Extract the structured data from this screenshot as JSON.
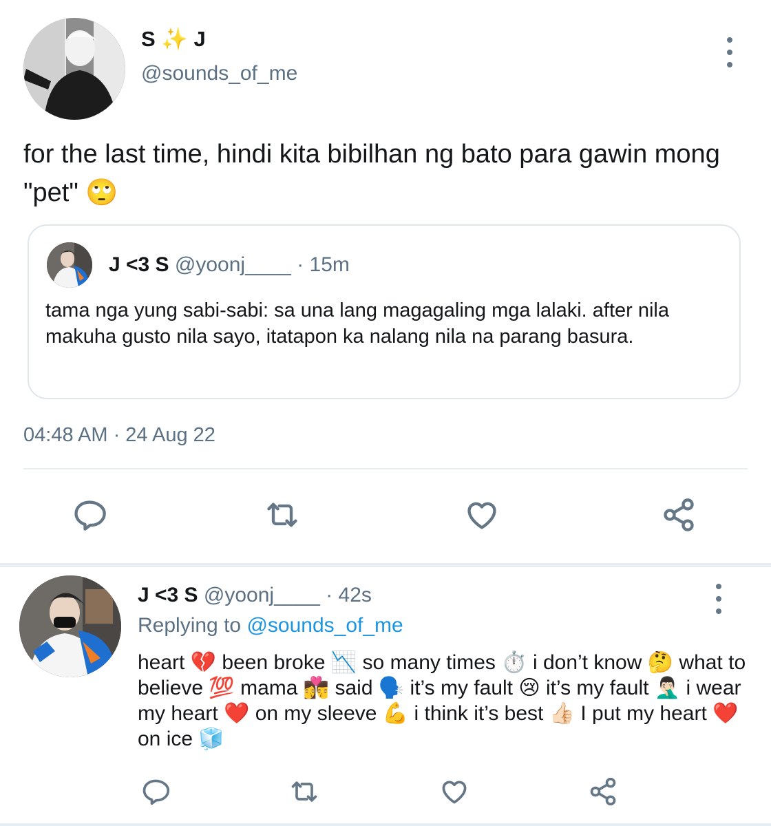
{
  "main_tweet": {
    "display_name": "S ✨ J",
    "handle": "@sounds_of_me",
    "text": "for the last time, hindi kita bibilhan ng bato para gawin mong \"pet\" 🙄",
    "timestamp": "04:48 AM · 24 Aug 22",
    "quoted": {
      "display_name": "J <3 S",
      "handle": "@yoonj____",
      "time": "· 15m",
      "text": "tama nga yung sabi-sabi: sa una lang magagaling mga lalaki. after nila makuha gusto nila sayo, itatapon ka nalang nila na parang basura."
    },
    "actions": [
      "reply-icon",
      "retweet-icon",
      "like-icon",
      "share-icon"
    ]
  },
  "reply": {
    "display_name": "J <3 S",
    "handle": "@yoonj____",
    "time": "· 42s",
    "replying_prefix": "Replying to",
    "replying_to": "@sounds_of_me",
    "text": "heart 💔 been broke 📉 so many times ⏱️ i don’t know 🤔 what to believe 💯 mama 👩‍❤️‍💋‍👨 said 🗣️ it’s my fault 😢 it’s my fault 🤦🏻‍♂️ i wear my heart ❤️ on my sleeve 💪 i think it’s best 👍🏻 I put my heart ❤️ on ice 🧊",
    "actions": [
      "reply-icon",
      "retweet-icon",
      "like-icon",
      "share-icon"
    ]
  },
  "colors": {
    "text": "#14171a",
    "secondary": "#5b7083",
    "link": "#1b95e0",
    "border": "#dfe6ec",
    "icon": "#657786"
  }
}
